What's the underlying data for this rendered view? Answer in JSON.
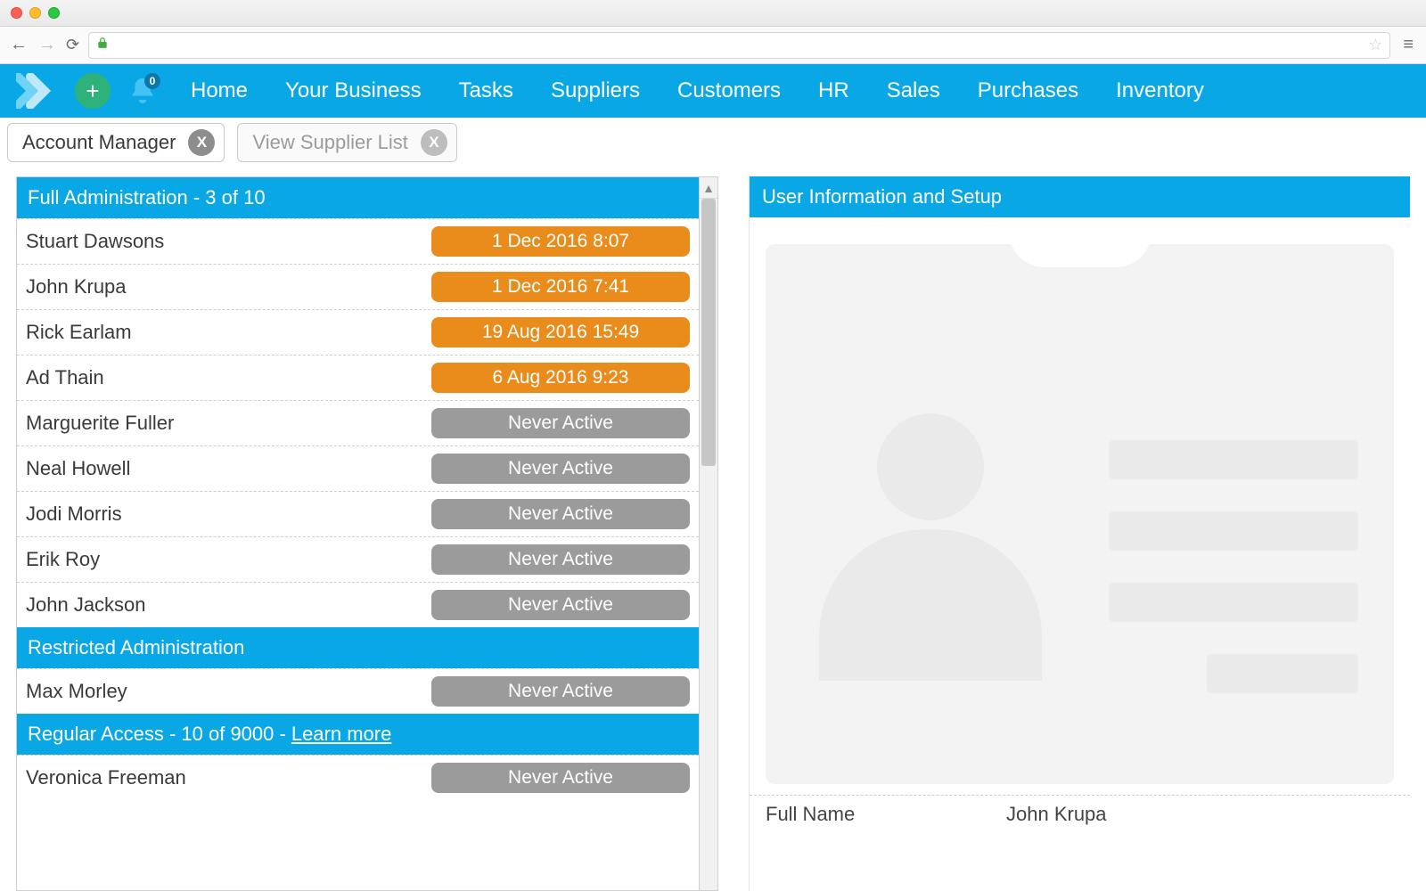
{
  "nav": {
    "items": [
      "Home",
      "Your Business",
      "Tasks",
      "Suppliers",
      "Customers",
      "HR",
      "Sales",
      "Purchases",
      "Inventory"
    ],
    "notif_count": "0"
  },
  "tabs": [
    {
      "label": "Account Manager",
      "active": true
    },
    {
      "label": "View Supplier List",
      "active": false
    }
  ],
  "groups": [
    {
      "title": "Full Administration - 3 of 10",
      "learn_more": null,
      "rows": [
        {
          "name": "Stuart Dawsons",
          "status": "1 Dec 2016 8:07",
          "kind": "orange"
        },
        {
          "name": "John Krupa",
          "status": "1 Dec 2016 7:41",
          "kind": "orange"
        },
        {
          "name": "Rick Earlam",
          "status": "19 Aug 2016 15:49",
          "kind": "orange"
        },
        {
          "name": "Ad Thain",
          "status": "6 Aug 2016 9:23",
          "kind": "orange"
        },
        {
          "name": "Marguerite Fuller",
          "status": "Never Active",
          "kind": "gray"
        },
        {
          "name": "Neal Howell",
          "status": "Never Active",
          "kind": "gray"
        },
        {
          "name": "Jodi Morris",
          "status": "Never Active",
          "kind": "gray"
        },
        {
          "name": "Erik Roy",
          "status": "Never Active",
          "kind": "gray"
        },
        {
          "name": "John Jackson",
          "status": "Never Active",
          "kind": "gray"
        }
      ]
    },
    {
      "title": "Restricted Administration",
      "learn_more": null,
      "rows": [
        {
          "name": "Max Morley",
          "status": "Never Active",
          "kind": "gray"
        }
      ]
    },
    {
      "title": "Regular Access - 10 of 9000 - ",
      "learn_more": "Learn more",
      "rows": [
        {
          "name": "Veronica Freeman",
          "status": "Never Active",
          "kind": "gray"
        }
      ]
    }
  ],
  "right": {
    "header": "User Information and Setup",
    "full_name_label": "Full Name",
    "full_name_value": "John Krupa"
  }
}
